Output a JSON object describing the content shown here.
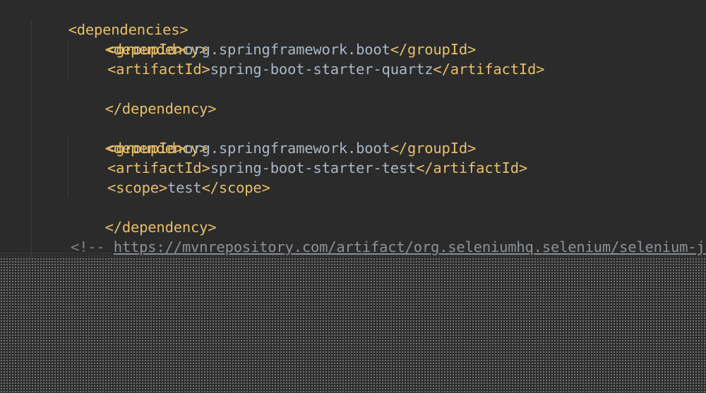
{
  "editor": {
    "colors": {
      "background": "#2b2b2b",
      "tag": "#e8bf6a",
      "text": "#a9b7c6",
      "comment": "#7f8288"
    },
    "lines": [
      {
        "open": "<dependencies>"
      },
      {
        "open": "<dependency>"
      },
      {
        "open": "<groupId>",
        "text": "org.springframework.boot",
        "close": "</groupId>"
      },
      {
        "open": "<artifactId>",
        "text": "spring-boot-starter-quartz",
        "close": "</artifactId>"
      },
      {
        "open": "</dependency>"
      },
      {
        "open": "<dependency>"
      },
      {
        "open": "<groupId>",
        "text": "org.springframework.boot",
        "close": "</groupId>"
      },
      {
        "open": "<artifactId>",
        "text": "spring-boot-starter-test",
        "close": "</artifactId>"
      },
      {
        "open": "<scope>",
        "text": "test",
        "close": "</scope>"
      },
      {
        "open": "</dependency>"
      },
      {
        "comment_prefix": "<!-- ",
        "comment_link": "https://mvnrepository.com/artifact/org.seleniumhq.selenium/selenium-java"
      }
    ]
  }
}
